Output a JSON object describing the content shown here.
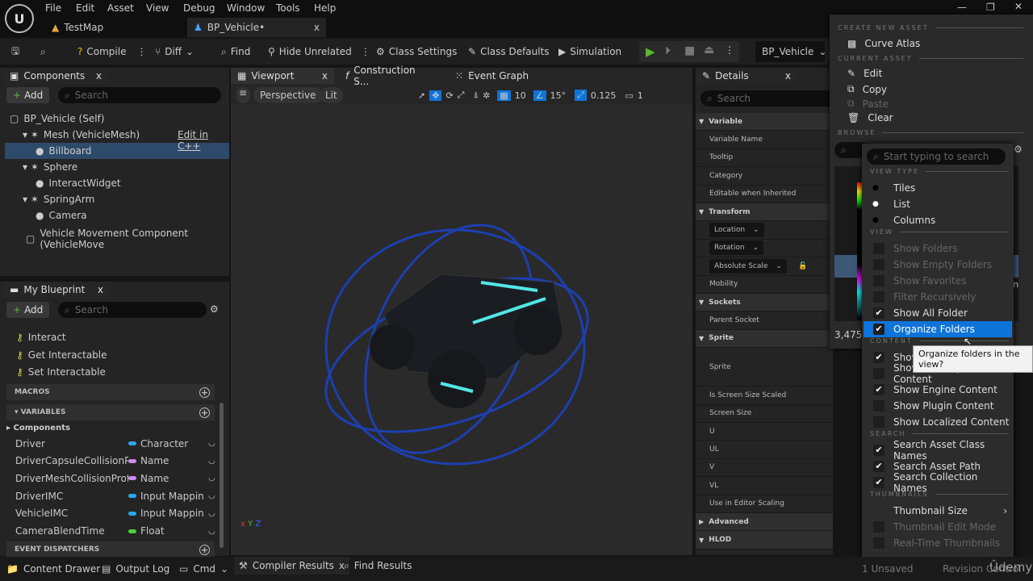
{
  "menu": [
    "File",
    "Edit",
    "Asset",
    "View",
    "Debug",
    "Window",
    "Tools",
    "Help"
  ],
  "tabs": [
    {
      "label": "TestMap"
    },
    {
      "label": "BP_Vehicle•",
      "close": "x"
    }
  ],
  "toolbar": {
    "compile": "Compile",
    "diff": "Diff",
    "find": "Find",
    "hide_unrelated": "Hide Unrelated",
    "class_settings": "Class Settings",
    "class_defaults": "Class Defaults",
    "simulation": "Simulation",
    "debug_object": "BP_Vehicle"
  },
  "components": {
    "title": "Components",
    "add": "Add",
    "search_placeholder": "Search",
    "edit_cpp": "Edit in C++",
    "items": [
      {
        "label": "BP_Vehicle (Self)",
        "indent": 0
      },
      {
        "label": "Mesh (VehicleMesh)",
        "indent": 1
      },
      {
        "label": "Billboard",
        "indent": 2,
        "selected": true
      },
      {
        "label": "Sphere",
        "indent": 1
      },
      {
        "label": "InteractWidget",
        "indent": 2
      },
      {
        "label": "SpringArm",
        "indent": 1
      },
      {
        "label": "Camera",
        "indent": 2
      }
    ],
    "movement": "Vehicle Movement Component (VehicleMove"
  },
  "my_blueprint": {
    "title": "My Blueprint",
    "add": "Add",
    "search_placeholder": "Search",
    "functions": [
      "Interact",
      "Get Interactable",
      "Set Interactable"
    ],
    "macros": "MACROS",
    "variables": "VARIABLES",
    "components_cat": "Components",
    "event_dispatchers": "EVENT DISPATCHERS",
    "vars": [
      {
        "name": "Driver",
        "type": "Character",
        "color": "#2aa6e8"
      },
      {
        "name": "DriverCapsuleCollisionPro",
        "type": "Name",
        "color": "#c98bf0"
      },
      {
        "name": "DriverMeshCollisionProfile",
        "type": "Name",
        "color": "#c98bf0"
      },
      {
        "name": "DriverIMC",
        "type": "Input Mapping",
        "color": "#2aa6e8"
      },
      {
        "name": "VehicleIMC",
        "type": "Input Mapping",
        "color": "#2aa6e8"
      },
      {
        "name": "CameraBlendTime",
        "type": "Float",
        "color": "#4cd23a"
      }
    ]
  },
  "viewport": {
    "tabs": [
      "Viewport",
      "Construction S...",
      "Event Graph"
    ],
    "perspective": "Perspective",
    "lit": "Lit",
    "grid": "10",
    "angle": "15°",
    "scale": "0.125",
    "camera_speed": "1"
  },
  "details": {
    "title": "Details",
    "search_placeholder": "Search",
    "rows": [
      {
        "label": "Variable",
        "head": true
      },
      {
        "label": "Variable Name"
      },
      {
        "label": "Tooltip"
      },
      {
        "label": "Category"
      },
      {
        "label": "Editable when Inherited"
      },
      {
        "label": "Transform",
        "head": true
      },
      {
        "label": "Location",
        "dd": true
      },
      {
        "label": "Rotation",
        "dd": true
      },
      {
        "label": "Absolute Scale",
        "dd": true
      },
      {
        "label": "Mobility"
      },
      {
        "label": "Sockets",
        "head": true
      },
      {
        "label": "Parent Socket"
      },
      {
        "label": "Sprite",
        "head": true
      },
      {
        "label": "Sprite",
        "tall": true
      },
      {
        "label": "Is Screen Size Scaled"
      },
      {
        "label": "Screen Size"
      },
      {
        "label": "U"
      },
      {
        "label": "UL"
      },
      {
        "label": "V"
      },
      {
        "label": "VL"
      },
      {
        "label": "Use in Editor Scaling"
      },
      {
        "label": "Advanced",
        "head": true,
        "collapsed": true
      },
      {
        "label": "HLOD",
        "head": true
      }
    ]
  },
  "content_popup": {
    "create_new_asset": "CREATE NEW ASSET",
    "curve_atlas": "Curve Atlas",
    "current_asset": "CURRENT ASSET",
    "edit": "Edit",
    "copy": "Copy",
    "paste": "Paste",
    "clear": "Clear",
    "browse": "BROWSE",
    "count": "3,475 i",
    "partial_right": "In"
  },
  "view_options": {
    "search_placeholder": "Start typing to search",
    "sections": [
      {
        "title": "VIEW TYPE",
        "items": [
          {
            "label": "Tiles",
            "radio": true,
            "on": false
          },
          {
            "label": "List",
            "radio": true,
            "on": true
          },
          {
            "label": "Columns",
            "radio": true,
            "on": false
          }
        ]
      },
      {
        "title": "VIEW",
        "items": [
          {
            "label": "Show Folders",
            "disabled": true
          },
          {
            "label": "Show Empty Folders",
            "disabled": true
          },
          {
            "label": "Show Favorites",
            "disabled": true
          },
          {
            "label": "Filter Recursively",
            "disabled": true
          },
          {
            "label": "Show All Folder",
            "on": true
          },
          {
            "label": "Organize Folders",
            "on": true,
            "highlight": true
          }
        ]
      },
      {
        "title": "CONTENT",
        "items": [
          {
            "label": "Show C++ Classes",
            "on": true
          },
          {
            "label": "Show Developers Content",
            "on": false
          },
          {
            "label": "Show Engine Content",
            "on": true
          },
          {
            "label": "Show Plugin Content",
            "on": false
          },
          {
            "label": "Show Localized Content",
            "on": false
          }
        ]
      },
      {
        "title": "SEARCH",
        "items": [
          {
            "label": "Search Asset Class Names",
            "on": true
          },
          {
            "label": "Search Asset Path",
            "on": true
          },
          {
            "label": "Search Collection Names",
            "on": true
          }
        ]
      },
      {
        "title": "THUMBNAILS",
        "items": [
          {
            "label": "Thumbnail Size",
            "submenu": true
          },
          {
            "label": "Thumbnail Edit Mode",
            "disabled": true
          },
          {
            "label": "Real-Time Thumbnails",
            "disabled": true
          }
        ]
      }
    ]
  },
  "tooltip": "Organize folders in the view?",
  "bottom": {
    "content_drawer": "Content Drawer",
    "output_log": "Output Log",
    "cmd": "Cmd",
    "compiler_results": "Compiler Results",
    "find_results": "Find Results",
    "unsaved": "1 Unsaved",
    "revision": "Revision Control"
  },
  "watermark": "Udemy",
  "colors": {
    "accent": "#0e74d9",
    "selection": "#2e4a6b",
    "play": "#5cb82f"
  }
}
